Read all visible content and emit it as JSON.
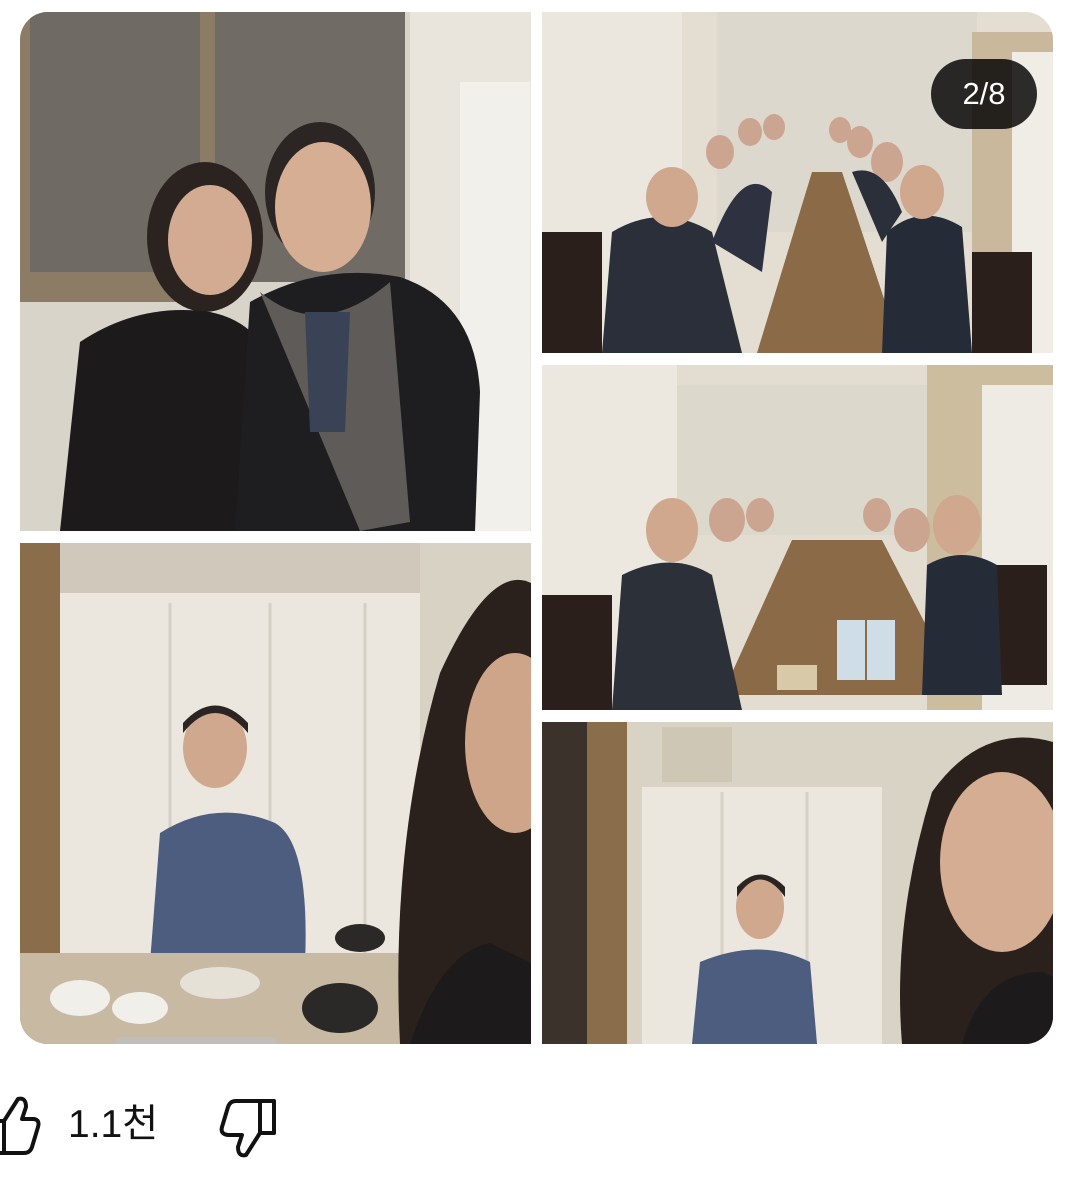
{
  "gallery": {
    "counter_text": "2/8",
    "photos": [
      {
        "name": "photo-two-people-posing"
      },
      {
        "name": "photo-man-at-table-selfie"
      },
      {
        "name": "photo-long-table-dinner"
      },
      {
        "name": "photo-dinner-group-wide"
      },
      {
        "name": "photo-man-arms-crossed-selfie"
      }
    ]
  },
  "actions": {
    "like_icon": "thumbs-up-icon",
    "like_count": "1.1천",
    "dislike_icon": "thumbs-down-icon"
  },
  "colors": {
    "counter_bg": "#000000",
    "counter_text": "#ffffff",
    "text": "#111111",
    "background": "#ffffff"
  }
}
